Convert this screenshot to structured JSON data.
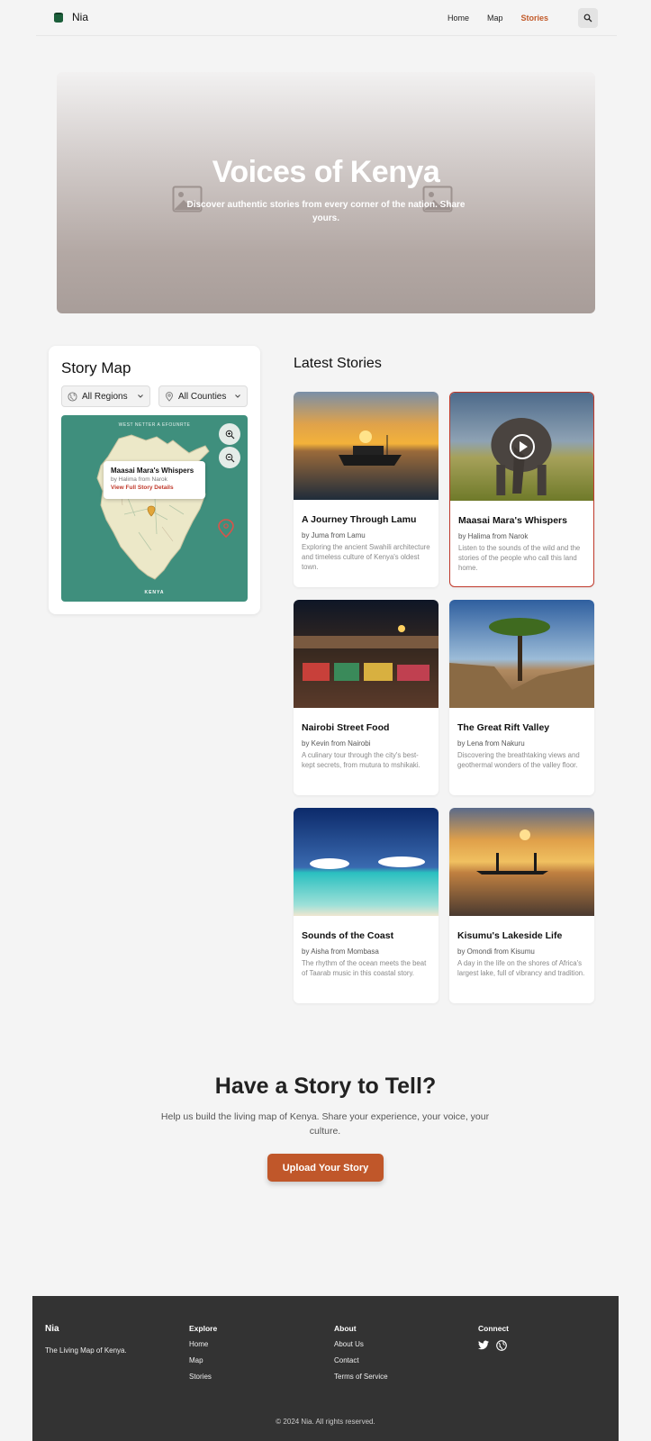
{
  "nav": {
    "brand": "Nia",
    "links": [
      {
        "label": "Home",
        "active": false
      },
      {
        "label": "Map",
        "active": false
      },
      {
        "label": "Stories",
        "active": true
      }
    ]
  },
  "hero": {
    "title": "Voices of Kenya",
    "subtitle": "Discover authentic stories from every corner of the nation. Share yours."
  },
  "story_map": {
    "title": "Story Map",
    "region_select": "All Regions",
    "county_select": "All Counties",
    "map_top_label": "WEST NETTER A EFOUNRTE",
    "map_bottom_label": "KENYA",
    "popup": {
      "title": "Maasai Mara's Whispers",
      "byline": "by Halima from Narok",
      "link": "View Full Story Details"
    }
  },
  "latest": {
    "title": "Latest Stories",
    "stories": [
      {
        "title": "A Journey Through Lamu",
        "byline": "by Juma from Lamu",
        "desc": "Exploring the ancient Swahili architecture and timeless culture of Kenya's oldest town."
      },
      {
        "title": "Maasai Mara's Whispers",
        "byline": "by Halima from Narok",
        "desc": "Listen to the sounds of the wild and the stories of the people who call this land home."
      },
      {
        "title": "Nairobi Street Food",
        "byline": "by Kevin from Nairobi",
        "desc": "A culinary tour through the city's best-kept secrets, from mutura to mshikaki."
      },
      {
        "title": "The Great Rift Valley",
        "byline": "by Lena from Nakuru",
        "desc": "Discovering the breathtaking views and geothermal wonders of the valley floor."
      },
      {
        "title": "Sounds of the Coast",
        "byline": "by Aisha from Mombasa",
        "desc": "The rhythm of the ocean meets the beat of Taarab music in this coastal story."
      },
      {
        "title": "Kisumu's Lakeside Life",
        "byline": "by Omondi from Kisumu",
        "desc": "A day in the life on the shores of Africa's largest lake, full of vibrancy and tradition."
      }
    ]
  },
  "cta": {
    "title": "Have a Story to Tell?",
    "text": "Help us build the living map of Kenya. Share your experience, your voice, your culture.",
    "button": "Upload Your Story"
  },
  "footer": {
    "brand": "Nia",
    "tagline": "The Living Map of Kenya.",
    "explore": {
      "title": "Explore",
      "links": [
        "Home",
        "Map",
        "Stories"
      ]
    },
    "about": {
      "title": "About",
      "links": [
        "About Us",
        "Contact",
        "Terms of Service"
      ]
    },
    "connect": {
      "title": "Connect",
      "icons": [
        "twitter-icon",
        "globe-icon"
      ]
    },
    "copyright": "© 2024 Nia. All rights reserved."
  },
  "colors": {
    "accent": "#c25a2a",
    "footer_bg": "#333333",
    "map_teal": "#3f8f7d",
    "selected_border": "#c0392b"
  }
}
